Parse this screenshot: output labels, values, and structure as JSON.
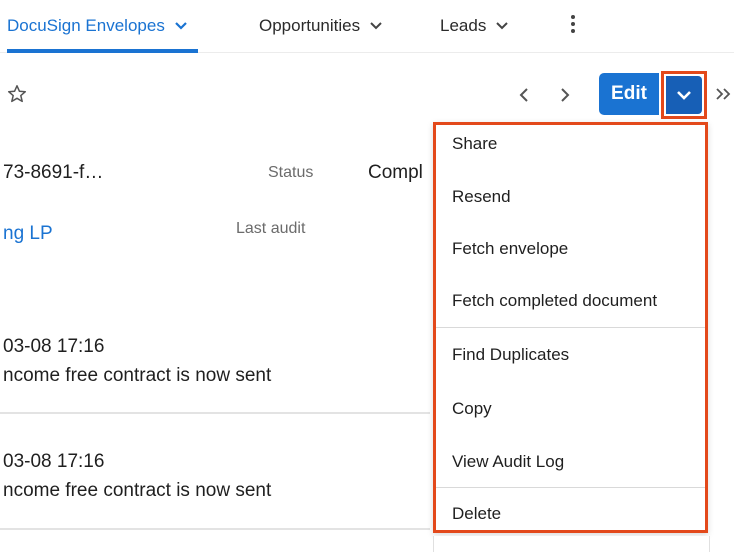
{
  "nav": {
    "tabs": [
      {
        "label": "DocuSign Envelopes",
        "active": true
      },
      {
        "label": "Opportunities",
        "active": false
      },
      {
        "label": "Leads",
        "active": false
      }
    ],
    "more_icon": "vertical-ellipsis-icon"
  },
  "header": {
    "favorite_icon": "star-outline-icon",
    "edit_label": "Edit",
    "actions_icon": "chevron-down-icon",
    "prev_icon": "chevron-left-icon",
    "next_icon": "chevron-right-icon",
    "expand_icon": "double-chevron-right-icon"
  },
  "fields": {
    "envelope_id_value": "73-8691-f…",
    "status_label": "Status",
    "status_value": "Compl",
    "related_value": "ng LP",
    "last_audit_label": "Last audit"
  },
  "activity": [
    {
      "time": "03-08 17:16",
      "message": "ncome free contract is now sent"
    },
    {
      "time": "03-08 17:16",
      "message": "ncome free contract is now sent"
    }
  ],
  "actions_menu": {
    "groups": [
      [
        "Share",
        "Resend",
        "Fetch envelope",
        "Fetch completed document"
      ],
      [
        "Find Duplicates",
        "Copy",
        "View Audit Log"
      ],
      [
        "Delete"
      ]
    ]
  },
  "colors": {
    "accent": "#1a73d2",
    "highlight_border": "#e3491b",
    "caret_button": "#175fb6"
  }
}
